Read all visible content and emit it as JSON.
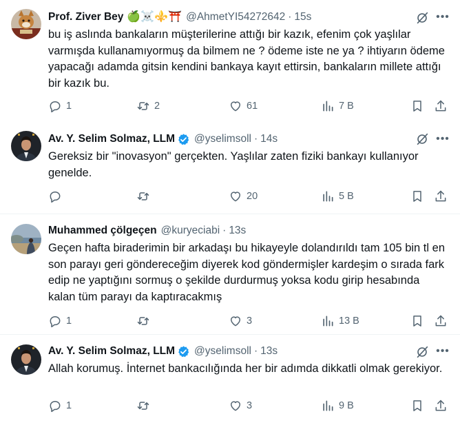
{
  "tweets": [
    {
      "name": "Prof. Ziver Bey",
      "emojis": "🍏☠️⚜️⛩️",
      "verified": false,
      "handle": "@AhmetYI54272642",
      "time": "15s",
      "text": "bu iş aslında bankaların müşterilerine attığı bir kazık, efenim çok yaşlılar varmışda kullanamıyormuş da bilmem ne ? ödeme iste ne ya ? ihtiyarın ödeme yapacağı adamda gitsin kendini bankaya kayıt ettirsin, bankaların millete attığı bir kazık bu.",
      "replies": "1",
      "retweets": "2",
      "likes": "61",
      "views": "7 B"
    },
    {
      "name": "Av. Y. Selim Solmaz, LLM",
      "emojis": "",
      "verified": true,
      "handle": "@yselimsoll",
      "time": "14s",
      "text": "Gereksiz bir \"inovasyon\" gerçekten. Yaşlılar zaten fiziki bankayı kullanıyor genelde.",
      "replies": "",
      "retweets": "",
      "likes": "20",
      "views": "5 B"
    },
    {
      "name": "Muhammed çölgeçen",
      "emojis": "",
      "verified": false,
      "handle": "@kuryeciabi",
      "time": "13s",
      "text": "Geçen hafta biraderimin bir arkadaşı bu hikayeyle dolandırıldı tam 105 bin tl en son parayı geri göndereceğim diyerek kod göndermişler kardeşim o sırada fark edip ne yaptığını sormuş o şekilde durdurmuş yoksa kodu girip hesabında kalan tüm parayı da kaptıracakmış",
      "replies": "1",
      "retweets": "",
      "likes": "3",
      "views": "13 B"
    },
    {
      "name": "Av. Y. Selim Solmaz, LLM",
      "emojis": "",
      "verified": true,
      "handle": "@yselimsoll",
      "time": "13s",
      "text": "Allah korumuş. İnternet bankacılığında her bir adımda dikkatli olmak gerekiyor.",
      "replies": "1",
      "retweets": "",
      "likes": "3",
      "views": "9 B"
    }
  ],
  "colors": {
    "text_primary": "#0f1419",
    "text_secondary": "#536471",
    "verified_blue": "#1d9bf0",
    "divider": "#eff3f4"
  },
  "icons": [
    "reply-icon",
    "retweet-icon",
    "like-icon",
    "views-icon",
    "bookmark-icon",
    "share-icon",
    "grok-icon",
    "more-icon",
    "verified-badge-icon"
  ]
}
